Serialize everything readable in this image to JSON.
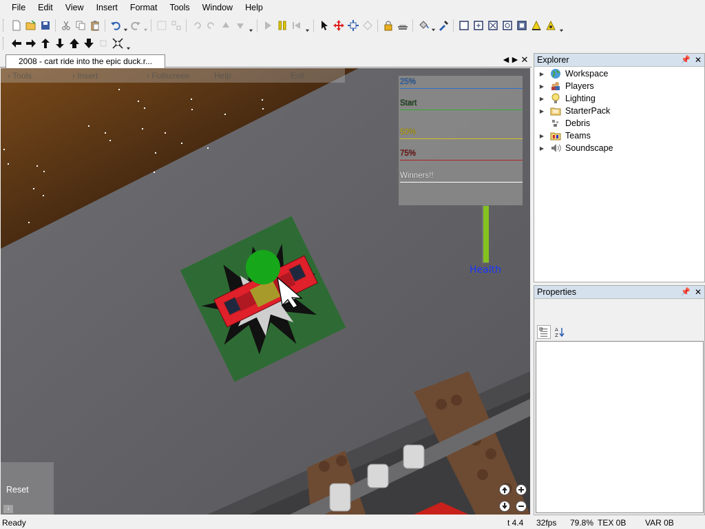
{
  "menubar": {
    "items": [
      "File",
      "Edit",
      "View",
      "Insert",
      "Format",
      "Tools",
      "Window",
      "Help"
    ]
  },
  "document": {
    "tab_title": "2008 - cart ride into the epic duck.r..."
  },
  "game": {
    "topbar": [
      "Tools",
      "Insert",
      "Fullscreen",
      "Help",
      "Exit"
    ],
    "leaderboard": [
      {
        "label": "25%",
        "color": "#2f6fc8"
      },
      {
        "label": "Start",
        "color": "#2cb12c"
      },
      {
        "label": "50%",
        "color": "#d8c020"
      },
      {
        "label": "75%",
        "color": "#b02020"
      },
      {
        "label": "Winners!!",
        "color": "#ffffff"
      }
    ],
    "health_label": "Health",
    "health_fraction": 1.0,
    "reset_label": "Reset"
  },
  "explorer": {
    "title": "Explorer",
    "items": [
      {
        "label": "Workspace",
        "icon": "globe-icon",
        "expandable": true
      },
      {
        "label": "Players",
        "icon": "players-icon",
        "expandable": true
      },
      {
        "label": "Lighting",
        "icon": "lightbulb-icon",
        "expandable": true
      },
      {
        "label": "StarterPack",
        "icon": "folder-icon",
        "expandable": true
      },
      {
        "label": "Debris",
        "icon": "debris-icon",
        "expandable": false
      },
      {
        "label": "Teams",
        "icon": "folder-icon",
        "expandable": true
      },
      {
        "label": "Soundscape",
        "icon": "speaker-icon",
        "expandable": true
      }
    ]
  },
  "properties": {
    "title": "Properties"
  },
  "statusbar": {
    "status": "Ready",
    "time": "t 4.4",
    "fps": "32fps",
    "cpu": "79.8%",
    "tex": "TEX 0B",
    "var": "VAR 0B"
  },
  "colors": {
    "panel_header": "#d6e1ee",
    "car_red": "#e0202a",
    "baseplate_green": "#2e6b34",
    "health_green": "#84c21f",
    "health_text": "#1a35ff"
  }
}
